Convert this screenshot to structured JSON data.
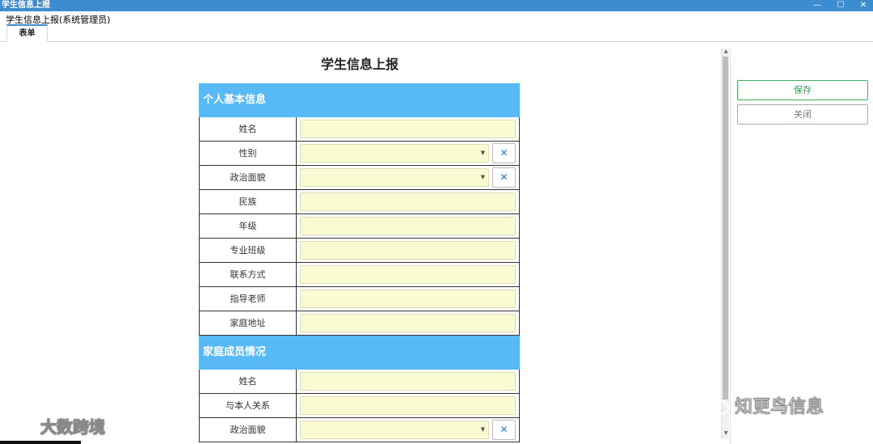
{
  "window": {
    "title": "学生信息上报",
    "controls": {
      "minimize": "—",
      "maximize": "☐",
      "close": "✕"
    }
  },
  "header": {
    "page_title": "学生信息上报(系统管理员)",
    "tabs": [
      {
        "label": "表单"
      }
    ]
  },
  "form": {
    "title": "学生信息上报",
    "sections": [
      {
        "title": "个人基本信息",
        "fields": [
          {
            "label": "姓名",
            "type": "text",
            "value": ""
          },
          {
            "label": "性别",
            "type": "select",
            "value": ""
          },
          {
            "label": "政治面貌",
            "type": "select",
            "value": ""
          },
          {
            "label": "民族",
            "type": "text",
            "value": ""
          },
          {
            "label": "年级",
            "type": "text",
            "value": ""
          },
          {
            "label": "专业班级",
            "type": "text",
            "value": ""
          },
          {
            "label": "联系方式",
            "type": "text",
            "value": ""
          },
          {
            "label": "指导老师",
            "type": "text",
            "value": ""
          },
          {
            "label": "家庭地址",
            "type": "text",
            "value": ""
          }
        ]
      },
      {
        "title": "家庭成员情况",
        "fields": [
          {
            "label": "姓名",
            "type": "text",
            "value": ""
          },
          {
            "label": "与本人关系",
            "type": "text",
            "value": ""
          },
          {
            "label": "政治面貌",
            "type": "select",
            "value": ""
          }
        ]
      }
    ],
    "clear_symbol": "✕",
    "dropdown_symbol": "▼"
  },
  "actions": {
    "save_label": "保存",
    "close_label": "关闭"
  },
  "watermarks": {
    "left_text": "大数跨境",
    "right_text": "知更鸟信息"
  },
  "colors": {
    "titlebar": "#3c8dd0",
    "section_header": "#57baf7",
    "input_background": "#fbfbd3",
    "save_accent": "#3fb15b"
  }
}
